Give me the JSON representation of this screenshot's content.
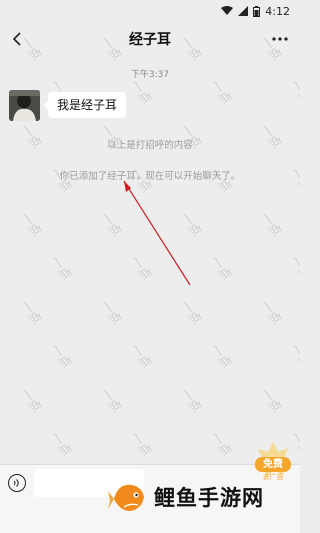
{
  "status_bar": {
    "time": "4:12"
  },
  "header": {
    "title": "经子耳"
  },
  "chat": {
    "timestamp": "下午3:37",
    "message": "我是经子耳",
    "system_notice_1": "以上是打招呼的内容",
    "system_notice_2": "你已添加了经子耳，现在可以开始聊天了。"
  },
  "watermark": {
    "text": "一点"
  },
  "promo": {
    "label": "免费",
    "sub": "去广告"
  },
  "brand": {
    "name": "鲤鱼手游网"
  },
  "colors": {
    "background": "#ededed",
    "bubble": "#ffffff",
    "arrow": "#c81e1e",
    "brand": "#f4a62a"
  }
}
